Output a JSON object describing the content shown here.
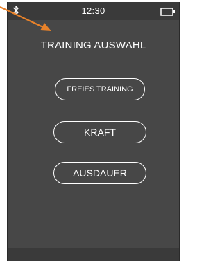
{
  "status_bar": {
    "time": "12:30",
    "bluetooth_icon": "bluetooth-icon",
    "battery_icon": "battery-icon"
  },
  "screen": {
    "title": "TRAINING AUSWAHL",
    "buttons": [
      {
        "label": "FREIES TRAINING"
      },
      {
        "label": "KRAFT"
      },
      {
        "label": "AUSDAUER"
      }
    ]
  },
  "colors": {
    "screen_background": "#474747",
    "status_bar_background": "#3a3a3a",
    "text": "#ffffff",
    "annotation_arrow": "#e8822a"
  },
  "annotation": {
    "icon": "arrow-icon"
  }
}
